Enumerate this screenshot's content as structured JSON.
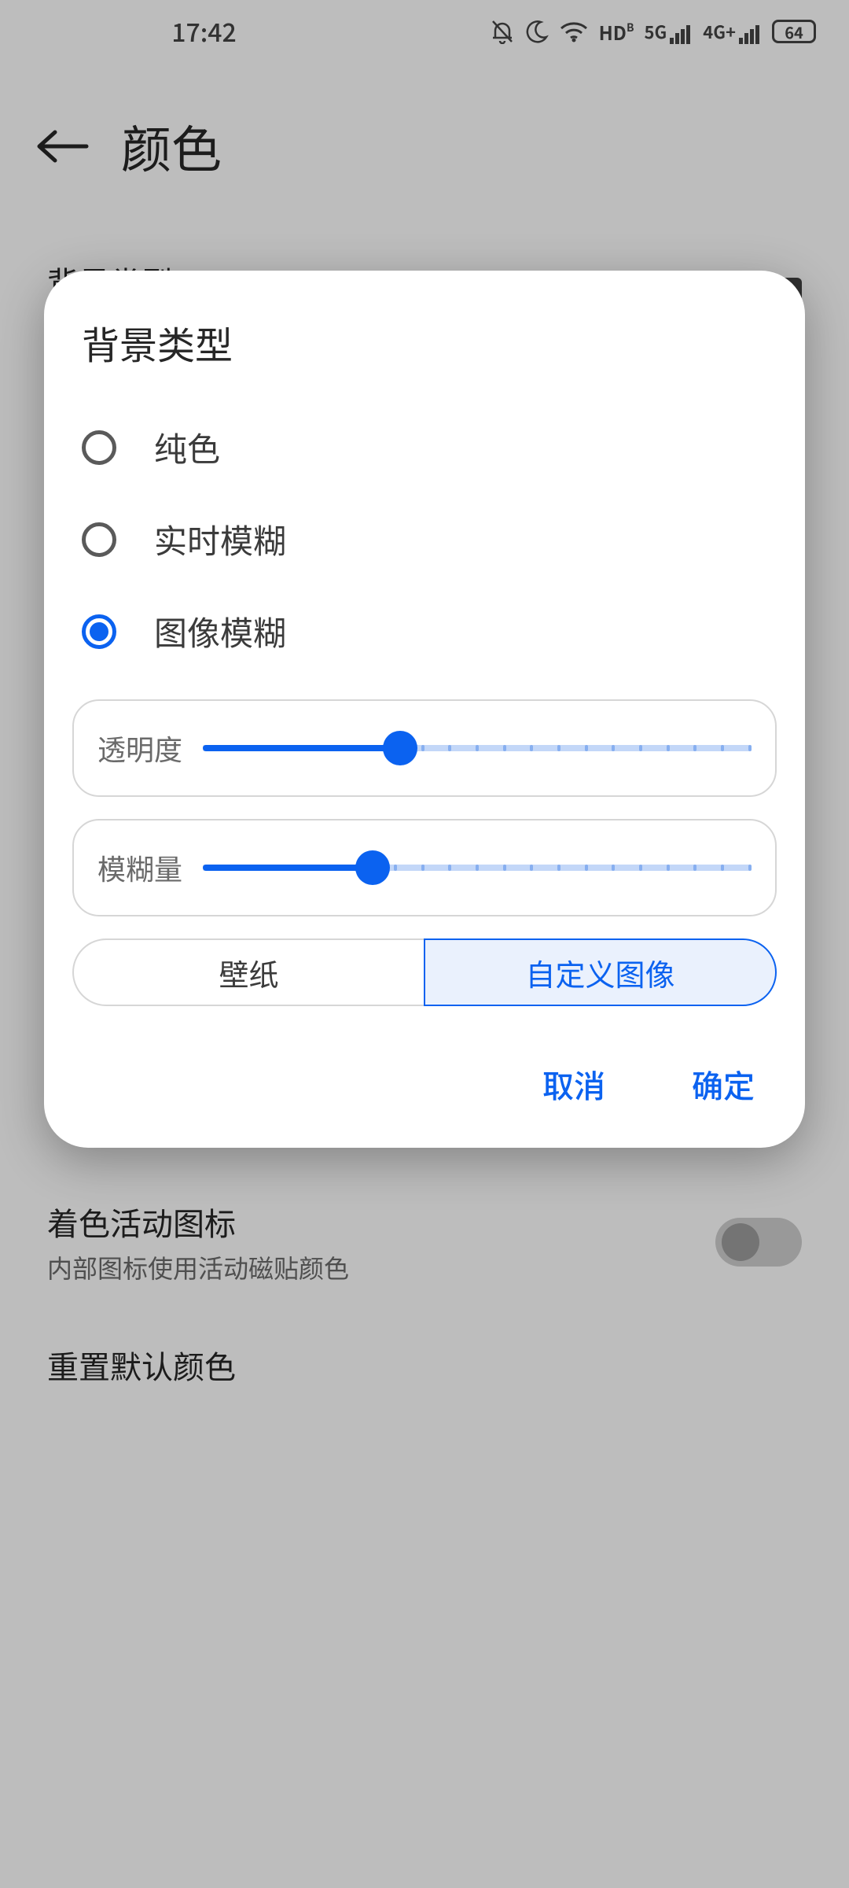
{
  "status": {
    "time": "17:42",
    "battery": "64",
    "net1": "5G",
    "net2": "4G+",
    "hd": "HD"
  },
  "page": {
    "title": "颜色",
    "bg_type_title": "背景类型",
    "bg_type_value": "图像模糊",
    "tint_title": "着色活动图标",
    "tint_sub": "内部图标使用活动磁贴颜色",
    "reset": "重置默认颜色"
  },
  "dialog": {
    "title": "背景类型",
    "options": [
      {
        "label": "纯色",
        "selected": false
      },
      {
        "label": "实时模糊",
        "selected": false
      },
      {
        "label": "图像模糊",
        "selected": true
      }
    ],
    "slider_opacity": {
      "label": "透明度",
      "value": 36
    },
    "slider_blur": {
      "label": "模糊量",
      "value": 31
    },
    "seg_wallpaper": "壁纸",
    "seg_custom": "自定义图像",
    "cancel": "取消",
    "ok": "确定"
  }
}
